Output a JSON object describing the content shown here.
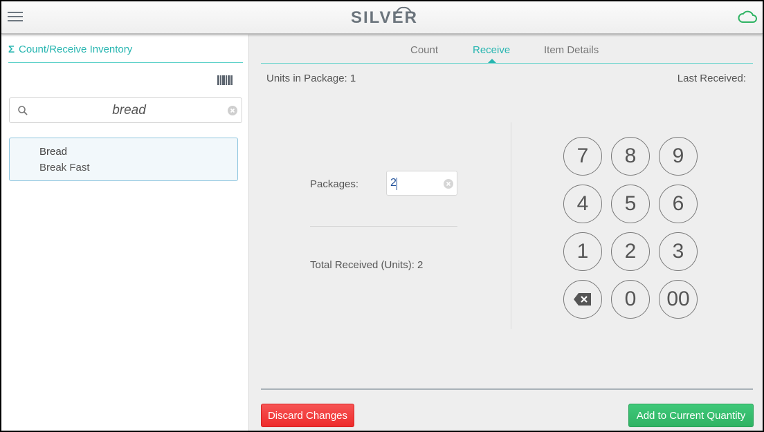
{
  "header": {
    "app_name": "SILVER",
    "menu_icon": "hamburger-menu-icon",
    "sync_icon": "cloud-icon",
    "sync_color": "#2fb363"
  },
  "sidebar": {
    "title_icon": "Σ",
    "title": "Count/Receive Inventory",
    "scan_icon": "barcode-icon",
    "search": {
      "value": "bread",
      "placeholder": "",
      "icon": "search-icon"
    },
    "results": [
      {
        "name": "Bread",
        "category": "Break Fast",
        "selected": true
      }
    ]
  },
  "main": {
    "tabs": [
      {
        "label": "Count",
        "active": false
      },
      {
        "label": "Receive",
        "active": true
      },
      {
        "label": "Item Details",
        "active": false
      }
    ],
    "units_in_package_label": "Units in Package: 1",
    "last_received_label": "Last Received:",
    "packages_label": "Packages:",
    "packages_value": "2",
    "total_received_label": "Total Received (Units): 2",
    "keypad": [
      "7",
      "8",
      "9",
      "4",
      "5",
      "6",
      "1",
      "2",
      "3",
      "backspace",
      "0",
      "00"
    ],
    "discard_label": "Discard Changes",
    "add_label": "Add to Current Quantity"
  },
  "colors": {
    "accent": "#26b5b0",
    "discard": "#ee2b2b",
    "add": "#2fb363"
  }
}
